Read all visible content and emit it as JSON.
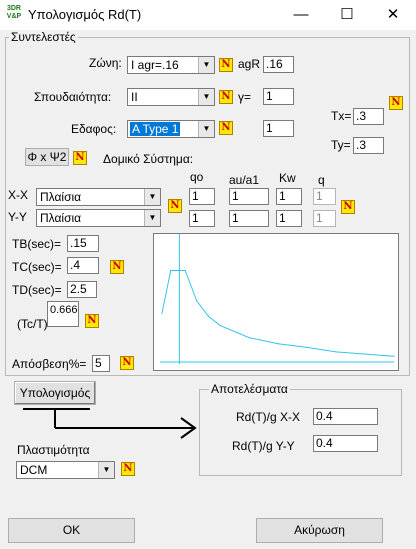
{
  "window": {
    "title": "Υπολογισμός Rd(T)",
    "icon_text_top": "3DR",
    "icon_text_bottom": "V&P",
    "minimize_glyph": "—",
    "maximize_glyph": "☐",
    "close_glyph": "✕"
  },
  "coefficients": {
    "group_title": "Συντελεστές",
    "zone_label": "Ζώνη:",
    "zone_value": "I    agr=.16",
    "agR_label": "agR",
    "agR_value": ".16",
    "importance_label": "Σπουδαιότητα:",
    "importance_value": "II",
    "gamma_label": "γ=",
    "gamma_value": "1",
    "soil_label": "Εδαφος:",
    "soil_value": "A Type 1",
    "soil_factor_value": "1",
    "tx_label": "Tx=",
    "tx_value": ".3",
    "ty_label": "Ty=",
    "ty_value": ".3",
    "phi_button_label": "Φ x Ψ2",
    "structural_system_label": "Δομικό Σύστημα:",
    "col_qo": "qo",
    "col_au_a1": "au/a1",
    "col_kw": "Kw",
    "col_q": "q",
    "row_xx": {
      "label": "X-X",
      "system": "Πλαίσια",
      "qo": "1",
      "au_a1": "1",
      "kw": "1",
      "q": "1"
    },
    "row_yy": {
      "label": "Y-Y",
      "system": "Πλαίσια",
      "qo": "1",
      "au_a1": "1",
      "kw": "1",
      "q": "1"
    },
    "tb_label": "TB(sec)=",
    "tb_value": ".15",
    "tc_label": "TC(sec)=",
    "tc_value": ".4",
    "td_label": "TD(sec)=",
    "td_value": "2.5",
    "tc_t_label": "(Tc/T)",
    "tc_t_value": "0.666",
    "damping_label": "Απόσβεση%=",
    "damping_value": "5",
    "n_icon_glyph": "N"
  },
  "calculate_button": "Υπολογισμός",
  "ductility": {
    "label": "Πλαστιμότητα",
    "value": "DCM"
  },
  "results": {
    "group_title": "Αποτελέσματα",
    "xx_label": "Rd(T)/g  X-X",
    "xx_value": "0.4",
    "yy_label": "Rd(T)/g  Y-Y",
    "yy_value": "0.4"
  },
  "ok_button": "OK",
  "cancel_button": "Ακύρωση",
  "colors": {
    "spectrum_curve": "#33c4e8",
    "n_icon_bg": "#ffe800",
    "n_icon_fg": "#d00000",
    "selection": "#0078d7"
  },
  "chart_data": {
    "type": "line",
    "title": "",
    "xlabel": "",
    "ylabel": "",
    "series": [
      {
        "x": [
          0,
          0.15,
          0.4,
          0.6,
          0.8,
          1.0,
          1.5,
          2.0,
          2.5,
          3.0,
          4.0
        ],
        "y": [
          0.4,
          0.75,
          0.75,
          0.5,
          0.375,
          0.3,
          0.2,
          0.15,
          0.12,
          0.083,
          0.047
        ]
      }
    ],
    "marker_x": 0.3,
    "xlim": [
      0,
      4
    ],
    "ylim": [
      0,
      1
    ],
    "grid": false
  }
}
